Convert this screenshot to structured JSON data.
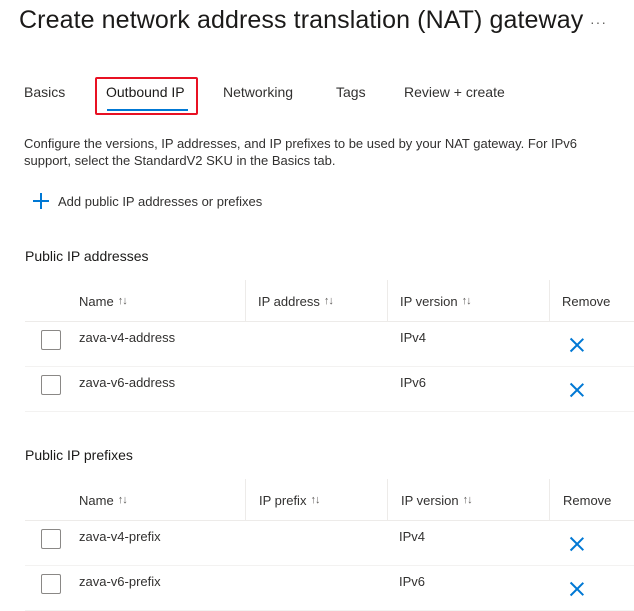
{
  "page": {
    "title": "Create network address translation (NAT) gateway",
    "more_label": "···"
  },
  "tabs": [
    {
      "label": "Basics"
    },
    {
      "label": "Outbound IP",
      "active": true
    },
    {
      "label": "Networking"
    },
    {
      "label": "Tags"
    },
    {
      "label": "Review + create"
    }
  ],
  "description": "Configure the versions, IP addresses, and IP prefixes to be used by your NAT gateway. For IPv6 support, select the StandardV2 SKU in the Basics tab.",
  "add_link": {
    "label": "Add public IP addresses or prefixes",
    "icon": "add-icon"
  },
  "addresses": {
    "title": "Public IP addresses",
    "columns": [
      "Name",
      "IP address",
      "IP version",
      "Remove"
    ],
    "rows": [
      {
        "name": "zava-v4-address",
        "ip": "",
        "version": "IPv4"
      },
      {
        "name": "zava-v6-address",
        "ip": "",
        "version": "IPv6"
      }
    ]
  },
  "prefixes": {
    "title": "Public IP prefixes",
    "columns": [
      "Name",
      "IP prefix",
      "IP version",
      "Remove"
    ],
    "rows": [
      {
        "name": "zava-v4-prefix",
        "ip": "",
        "version": "IPv4"
      },
      {
        "name": "zava-v6-prefix",
        "ip": "",
        "version": "IPv6"
      }
    ]
  },
  "icons": {
    "sort": "sort-arrows-icon",
    "remove": "close-icon"
  },
  "colors": {
    "accent": "#0078d4",
    "highlight": "#e81123"
  }
}
